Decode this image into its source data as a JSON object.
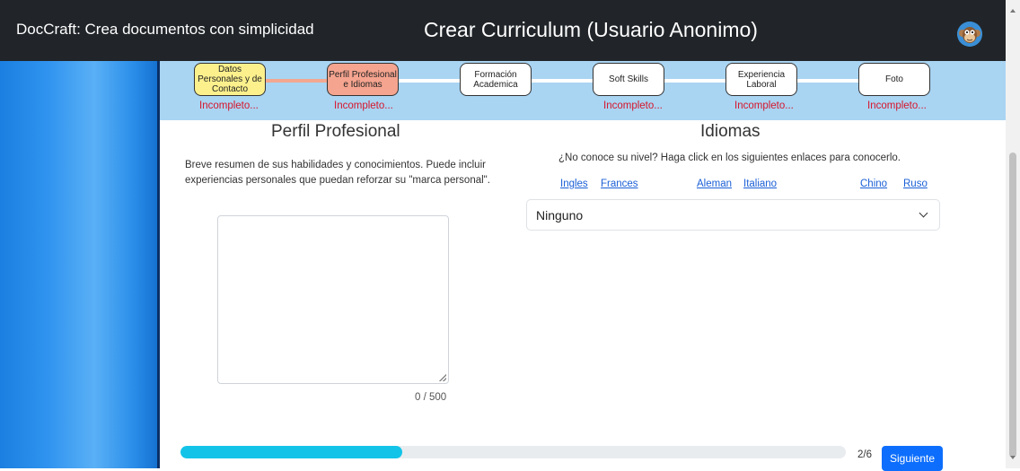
{
  "header": {
    "brand": "DocCraft: Crea documentos con simplicidad",
    "title": "Crear Curriculum (Usuario Anonimo)",
    "avatar_icon": "monkey-avatar-icon"
  },
  "stepper": {
    "steps": [
      {
        "label": "Datos Personales y de Contacto",
        "status": "Incompleto...",
        "state": "current-done",
        "color": "#fbf08c"
      },
      {
        "label": "Perfil Profesional e Idiomas",
        "status": "Incompleto...",
        "state": "active",
        "color": "#f5a48f"
      },
      {
        "label": "Formación Academica",
        "status": "",
        "state": "pending",
        "color": "#ffffff"
      },
      {
        "label": "Soft Skills",
        "status": "Incompleto...",
        "state": "pending",
        "color": "#ffffff"
      },
      {
        "label": "Experiencia Laboral",
        "status": "Incompleto...",
        "state": "pending",
        "color": "#ffffff"
      },
      {
        "label": "Foto",
        "status": "Incompleto...",
        "state": "pending",
        "color": "#ffffff"
      }
    ],
    "status_color": "#d6162c"
  },
  "perfil": {
    "heading": "Perfil Profesional",
    "description": "Breve resumen de sus habilidades y conocimientos. Puede incluir experiencias personales que puedan reforzar su \"marca personal\".",
    "textarea_value": "",
    "counter": "0 / 500"
  },
  "idiomas": {
    "heading": "Idiomas",
    "question": "¿No conoce su nivel? Haga click en los siguientes enlaces para conocerlo.",
    "links": [
      "Ingles",
      "Frances",
      "Aleman",
      "Italiano",
      "Chino",
      "Ruso"
    ],
    "selected_level": "Ninguno"
  },
  "footer": {
    "progress_fraction": 0.333,
    "step_count": "2/6",
    "next_label": "Siguiente"
  },
  "colors": {
    "header_bg": "#212529",
    "stepper_bg": "#a9d4f2",
    "progress": "#13c4e8",
    "primary": "#0d6efd"
  }
}
